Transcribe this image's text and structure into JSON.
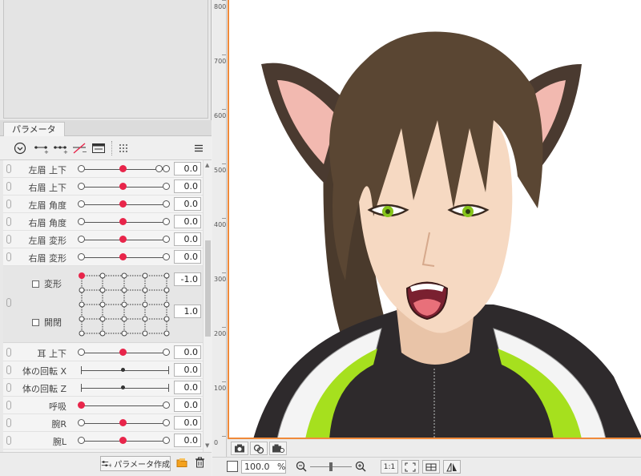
{
  "panel_tab": "パラメータ",
  "parameters": [
    {
      "label": "左眉 上下",
      "value": "0.0"
    },
    {
      "label": "右眉 上下",
      "value": "0.0"
    },
    {
      "label": "左眉 角度",
      "value": "0.0"
    },
    {
      "label": "右眉 角度",
      "value": "0.0"
    },
    {
      "label": "左眉 変形",
      "value": "0.0"
    },
    {
      "label": "右眉 変形",
      "value": "0.0"
    },
    {
      "label": "耳 上下",
      "value": "0.0"
    },
    {
      "label": "体の回転 X",
      "value": "0.0"
    },
    {
      "label": "体の回転 Z",
      "value": "0.0"
    },
    {
      "label": "呼吸",
      "value": "0.0"
    },
    {
      "label": "腕R",
      "value": "0.0"
    },
    {
      "label": "腕L",
      "value": "0.0"
    }
  ],
  "blend": {
    "label_a": "変形",
    "value_a": "-1.0",
    "label_b": "開閉",
    "value_b": "1.0"
  },
  "create_button": "パラメータ作成",
  "ruler_labels": [
    "800",
    "700",
    "600",
    "500",
    "400",
    "300",
    "200",
    "100",
    "0"
  ],
  "zoom": {
    "value": "100.0",
    "unit": "%"
  },
  "ratio_button": "1:1",
  "accent_color": "#e8254a",
  "canvas_border_color": "#f08a3a"
}
